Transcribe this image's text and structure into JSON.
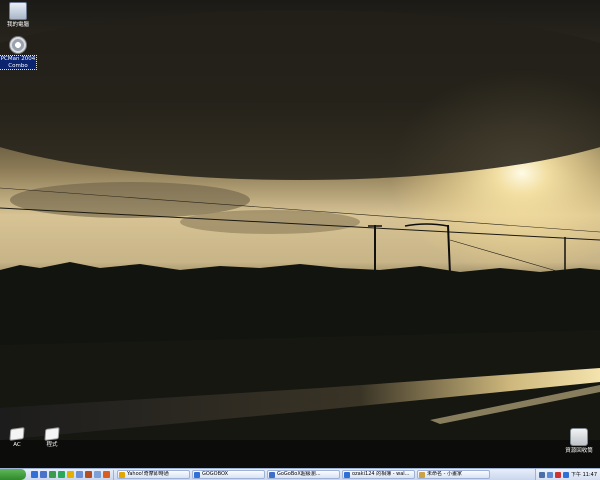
{
  "desktop": {
    "icons": [
      {
        "label": "我的電腦"
      },
      {
        "label": "PCMan 2004\nCombo"
      },
      {
        "label": "AC"
      },
      {
        "label": "程式"
      },
      {
        "label": "資源回收筒"
      }
    ]
  },
  "taskbar": {
    "quick_launch": [
      {
        "icon": "ie-icon",
        "color": "#2f6fd6"
      },
      {
        "icon": "show-desktop-icon",
        "color": "#4a72c8"
      },
      {
        "icon": "media-icon",
        "color": "#3a9b4a"
      },
      {
        "icon": "msn-icon",
        "color": "#2aa85a"
      },
      {
        "icon": "smiley-icon",
        "color": "#e5b100"
      },
      {
        "icon": "mail-icon",
        "color": "#6a8fd6"
      },
      {
        "icon": "winamp-icon",
        "color": "#b44d1f"
      },
      {
        "icon": "app-icon",
        "color": "#7aa2d8"
      },
      {
        "icon": "globe-icon",
        "color": "#d85f1e"
      }
    ],
    "tasks": [
      {
        "label": "Yahoo!奇摩即時通",
        "icon": "yahoo-messenger-icon",
        "color": "#e4a600"
      },
      {
        "label": "GOGOBOX",
        "icon": "ie-icon",
        "color": "#2f6fd6"
      },
      {
        "label": "GoGoBoX超級瀏...",
        "icon": "window-icon",
        "color": "#3d6fc7"
      },
      {
        "label": "ozaki124 的相簿 - wal...",
        "icon": "ie-icon",
        "color": "#2f6fd6"
      },
      {
        "label": "未命名 - 小畫家",
        "icon": "paint-icon",
        "color": "#c9a24a"
      }
    ],
    "tray_icons": [
      {
        "icon": "volume-icon",
        "color": "#4b6ea8"
      },
      {
        "icon": "network-icon",
        "color": "#5d8ad2"
      },
      {
        "icon": "shield-icon",
        "color": "#c33"
      },
      {
        "icon": "app-tray-icon",
        "color": "#2f6fd6"
      }
    ],
    "clock": "下午 11:47"
  }
}
